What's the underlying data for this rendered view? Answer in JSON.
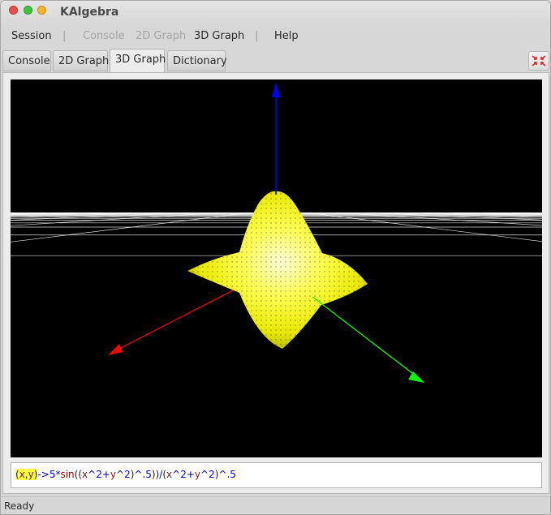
{
  "window": {
    "title": "KAlgebra"
  },
  "menu": {
    "items": [
      {
        "label": "Session",
        "enabled": true
      },
      {
        "label": "Console",
        "enabled": false
      },
      {
        "label": "2D Graph",
        "enabled": false
      },
      {
        "label": "3D Graph",
        "enabled": true
      },
      {
        "label": "Help",
        "enabled": true
      }
    ],
    "separator": "|"
  },
  "tabs": [
    {
      "label": "Console",
      "active": false
    },
    {
      "label": "2D Graph",
      "active": false
    },
    {
      "label": "3D Graph",
      "active": true
    },
    {
      "label": "Dictionary",
      "active": false
    }
  ],
  "corner_button_icon": "fullscreen-icon",
  "plot": {
    "background": "#000000",
    "surface_color": "#ffff00",
    "grid_color": "#ffffff",
    "axis_colors": {
      "x": "#ff0000",
      "y": "#00ff00",
      "z": "#0000ff"
    }
  },
  "expression": {
    "tokens": [
      {
        "text": "(",
        "color": "#222222",
        "highlight": "#ffff44"
      },
      {
        "text": "x",
        "color": "#7a1a1a",
        "highlight": "#ffff44"
      },
      {
        "text": ",",
        "color": "#222222",
        "highlight": "#ffff44"
      },
      {
        "text": "y",
        "color": "#7a1a1a",
        "highlight": "#ffff44"
      },
      {
        "text": ")",
        "color": "#222222",
        "highlight": "#ffff44"
      },
      {
        "text": "->",
        "color": "#0000aa",
        "highlight": ""
      },
      {
        "text": "5",
        "color": "#0000ff",
        "highlight": ""
      },
      {
        "text": "*",
        "color": "#0000aa",
        "highlight": ""
      },
      {
        "text": "sin",
        "color": "#aa0000",
        "highlight": ""
      },
      {
        "text": "((",
        "color": "#222222",
        "highlight": ""
      },
      {
        "text": "x",
        "color": "#7a1a1a",
        "highlight": ""
      },
      {
        "text": "^",
        "color": "#0000aa",
        "highlight": ""
      },
      {
        "text": "2",
        "color": "#0000ff",
        "highlight": ""
      },
      {
        "text": "+",
        "color": "#0000aa",
        "highlight": ""
      },
      {
        "text": "y",
        "color": "#7a1a1a",
        "highlight": ""
      },
      {
        "text": "^",
        "color": "#0000aa",
        "highlight": ""
      },
      {
        "text": "2",
        "color": "#0000ff",
        "highlight": ""
      },
      {
        "text": ")",
        "color": "#222222",
        "highlight": ""
      },
      {
        "text": "^",
        "color": "#0000aa",
        "highlight": ""
      },
      {
        "text": ".5",
        "color": "#0000ff",
        "highlight": ""
      },
      {
        "text": "))",
        "color": "#222222",
        "highlight": ""
      },
      {
        "text": "/",
        "color": "#0000aa",
        "highlight": ""
      },
      {
        "text": "(",
        "color": "#222222",
        "highlight": ""
      },
      {
        "text": "x",
        "color": "#7a1a1a",
        "highlight": ""
      },
      {
        "text": "^",
        "color": "#0000aa",
        "highlight": ""
      },
      {
        "text": "2",
        "color": "#0000ff",
        "highlight": ""
      },
      {
        "text": "+",
        "color": "#0000aa",
        "highlight": ""
      },
      {
        "text": "y",
        "color": "#7a1a1a",
        "highlight": ""
      },
      {
        "text": "^",
        "color": "#0000aa",
        "highlight": ""
      },
      {
        "text": "2",
        "color": "#0000ff",
        "highlight": ""
      },
      {
        "text": ")",
        "color": "#222222",
        "highlight": ""
      },
      {
        "text": "^",
        "color": "#0000aa",
        "highlight": ""
      },
      {
        "text": ".5",
        "color": "#0000ff",
        "highlight": ""
      }
    ]
  },
  "status": {
    "text": "Ready"
  }
}
